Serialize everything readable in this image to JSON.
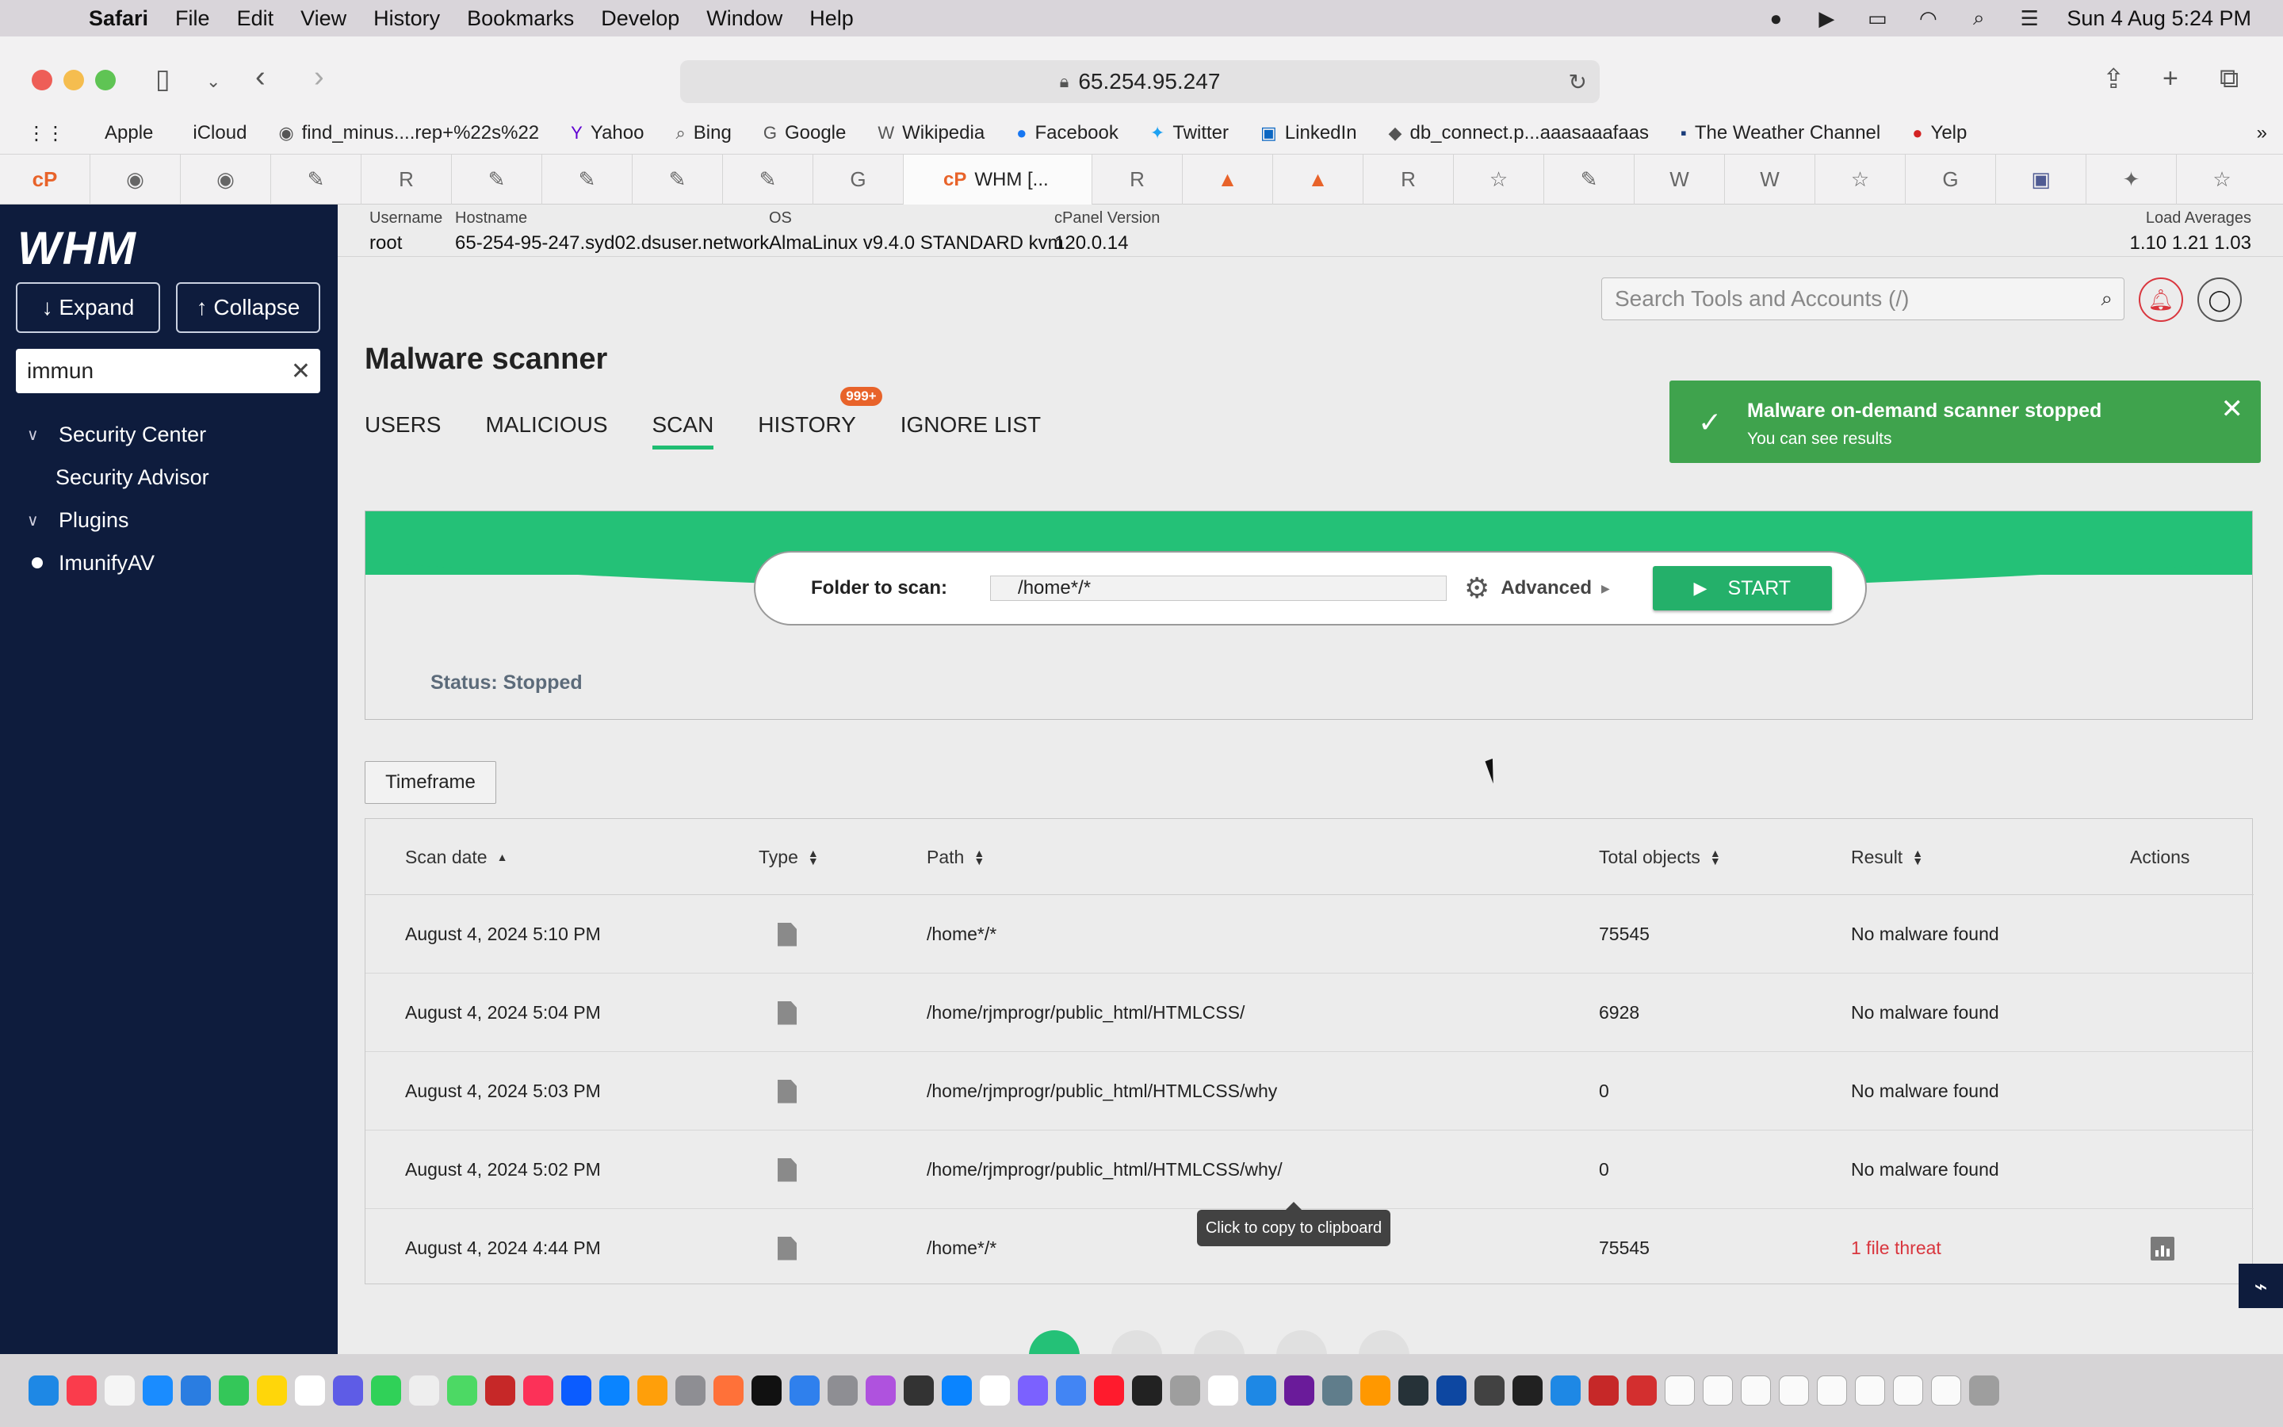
{
  "menubar": {
    "app": "Safari",
    "items": [
      "File",
      "Edit",
      "View",
      "History",
      "Bookmarks",
      "Develop",
      "Window",
      "Help"
    ],
    "datetime": "Sun 4 Aug  5:24 PM"
  },
  "browser": {
    "url": "65.254.95.247",
    "favorites": [
      "Apple",
      "iCloud",
      "find_minus....rep+%22s%22",
      "Yahoo",
      "Bing",
      "Google",
      "Wikipedia",
      "Facebook",
      "Twitter",
      "LinkedIn",
      "db_connect.p...aaasaaafaas",
      "The Weather Channel",
      "Yelp"
    ],
    "active_tab": "WHM [..."
  },
  "sidebar": {
    "logo": "WHM",
    "expand_label": "↓ Expand",
    "collapse_label": "↑ Collapse",
    "search_value": "immun",
    "items": [
      {
        "label": "Security Center"
      },
      {
        "label": "Security Advisor"
      },
      {
        "label": "Plugins"
      },
      {
        "label": "ImunifyAV"
      }
    ]
  },
  "server_info": {
    "username_label": "Username",
    "username": "root",
    "hostname_label": "Hostname",
    "hostname": "65-254-95-247.syd02.dsuser.network",
    "os_label": "OS",
    "os": "AlmaLinux v9.4.0 STANDARD kvm",
    "cpanel_label": "cPanel Version",
    "cpanel": "120.0.14",
    "load_label": "Load Averages",
    "load": "1.10  1.21  1.03"
  },
  "header": {
    "search_placeholder": "Search Tools and Accounts (/)"
  },
  "page": {
    "title": "Malware scanner",
    "tabs": [
      "USERS",
      "MALICIOUS",
      "SCAN",
      "HISTORY",
      "IGNORE LIST"
    ],
    "history_badge": "999+"
  },
  "toast": {
    "title": "Malware on-demand scanner stopped",
    "message": "You can see results"
  },
  "scan": {
    "folder_label": "Folder to scan:",
    "folder_value": "/home*/*",
    "advanced_label": "Advanced",
    "start_label": "START",
    "status": "Status: Stopped"
  },
  "timeframe_label": "Timeframe",
  "table": {
    "headers": [
      "Scan date",
      "Type",
      "Path",
      "Total objects",
      "Result",
      "Actions"
    ],
    "rows": [
      {
        "date": "August 4, 2024 5:10 PM",
        "path": "/home*/*",
        "total": "75545",
        "result": "No malware found"
      },
      {
        "date": "August 4, 2024 5:04 PM",
        "path": "/home/rjmprogr/public_html/HTMLCSS/",
        "total": "6928",
        "result": "No malware found"
      },
      {
        "date": "August 4, 2024 5:03 PM",
        "path": "/home/rjmprogr/public_html/HTMLCSS/why",
        "total": "0",
        "result": "No malware found"
      },
      {
        "date": "August 4, 2024 5:02 PM",
        "path": "/home/rjmprogr/public_html/HTMLCSS/why/",
        "total": "0",
        "result": "No malware found"
      },
      {
        "date": "August 4, 2024 4:44 PM",
        "path": "/home*/*",
        "total": "75545",
        "result": "1 file threat"
      }
    ]
  },
  "tooltip": "Click to copy to clipboard",
  "colors": {
    "sidebar_bg": "#0e1c3d",
    "accent_green": "#24c177",
    "toast_green": "#3fa34d",
    "threat_red": "#d9363e",
    "badge_orange": "#e8632a"
  }
}
